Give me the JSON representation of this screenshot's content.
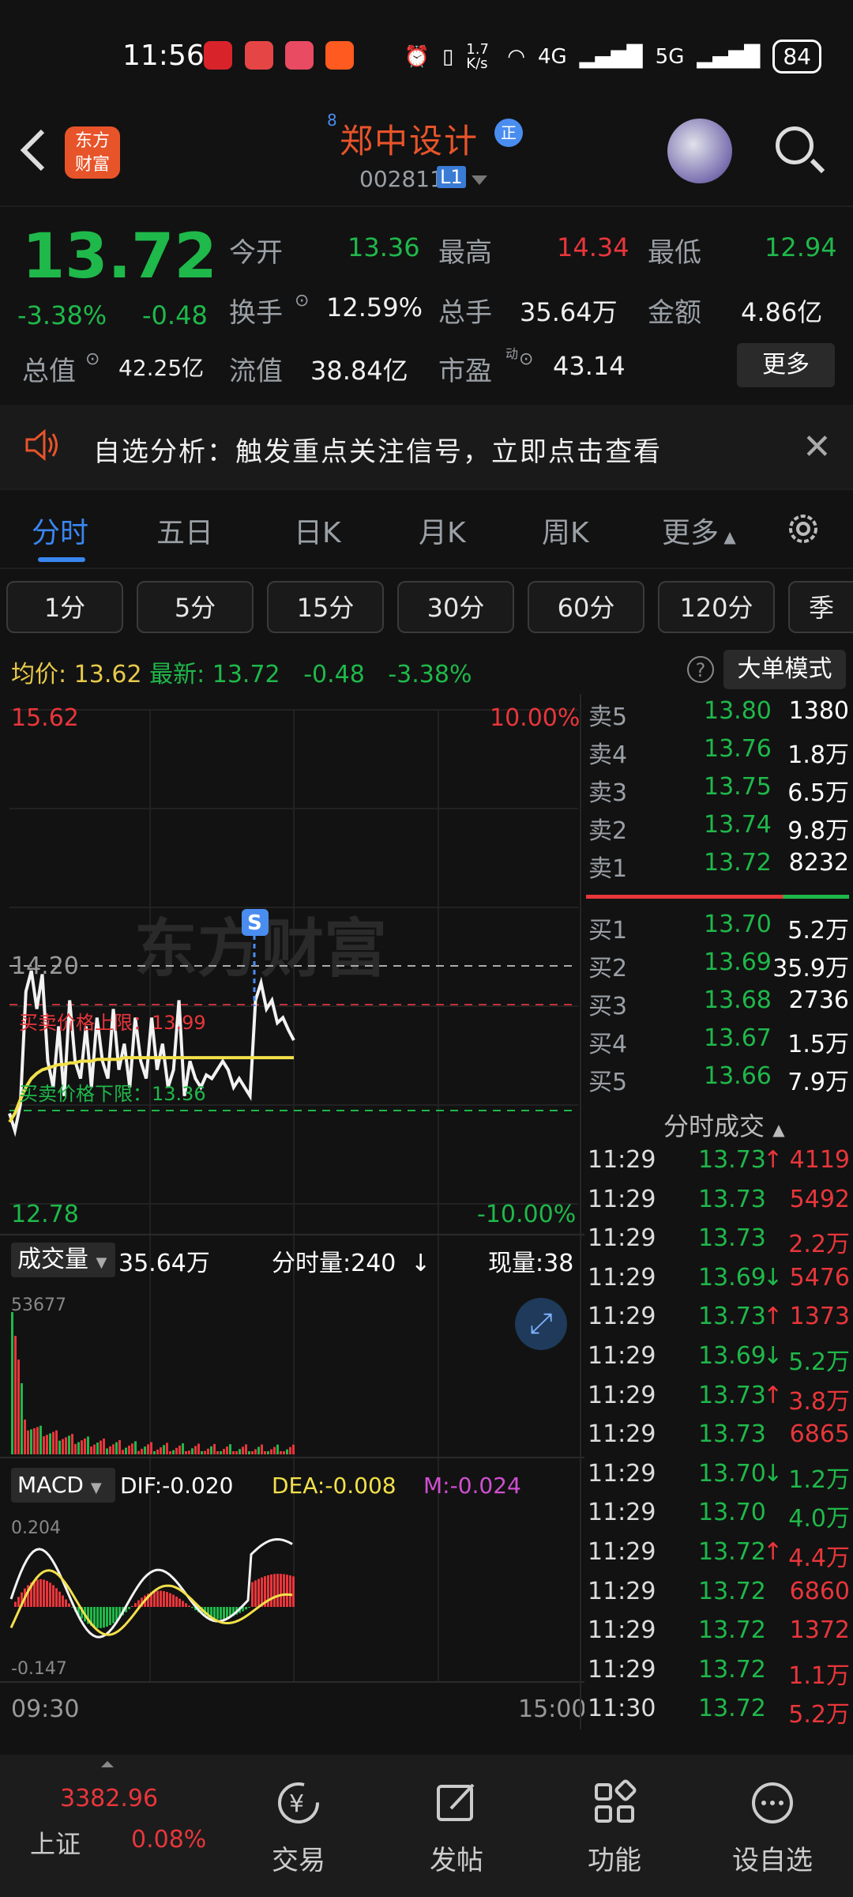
{
  "status_bar": {
    "time": "11:56",
    "speed": "1.7\nK/s",
    "net1": "4G",
    "net2": "5G",
    "battery": "84"
  },
  "header": {
    "stock_name": "郑中设计",
    "superscript": "8",
    "badge": "正",
    "code": "002811",
    "level": "L1",
    "logo_line1": "东方",
    "logo_line2": "财富"
  },
  "quote": {
    "price": "13.72",
    "pct": "-3.38%",
    "change": "-0.48",
    "open_label": "今开",
    "open": "13.36",
    "high_label": "最高",
    "high": "14.34",
    "low_label": "最低",
    "low": "12.94",
    "turnover_label": "换手",
    "turnover": "12.59%",
    "volume_label": "总手",
    "volume": "35.64万",
    "amount_label": "金额",
    "amount": "4.86亿",
    "mcap_label": "总值",
    "mcap": "42.25亿",
    "float_label": "流值",
    "float": "38.84亿",
    "pe_label": "市盈",
    "pe_sup": "动",
    "pe": "43.14",
    "more": "更多"
  },
  "banner": {
    "text": "自选分析：触发重点关注信号，立即点击查看"
  },
  "tabs": [
    "分时",
    "五日",
    "日K",
    "月K",
    "周K",
    "更多"
  ],
  "intervals": [
    "1分",
    "5分",
    "15分",
    "30分",
    "60分",
    "120分",
    "季"
  ],
  "summary": {
    "avg_label": "均价:",
    "avg": "13.62",
    "latest_label": "最新:",
    "latest": "13.72",
    "change": "-0.48",
    "pct": "-3.38%",
    "big_order": "大单模式"
  },
  "chart": {
    "y_top": "15.62",
    "y_bottom": "12.78",
    "pct_top": "10.00%",
    "pct_bottom": "-10.00%",
    "ref_line": "14.20",
    "upper_label": "买卖价格上限：13.99",
    "lower_label": "买卖价格下限：13.36",
    "s_marker": "S",
    "watermark": "东方财富",
    "time_start": "09:30",
    "time_end": "15:00"
  },
  "chart_data": {
    "type": "line",
    "series": [
      {
        "name": "价格",
        "values": [
          13.3,
          13.2,
          13.35,
          14.0,
          14.12,
          13.9,
          14.1,
          13.6,
          13.45,
          13.8,
          13.4,
          13.95,
          13.6,
          13.5,
          13.8,
          13.45,
          13.85,
          13.6,
          13.5,
          13.9,
          13.55,
          13.7,
          13.45,
          13.85,
          13.6,
          13.5,
          13.85,
          13.55,
          13.7,
          13.45,
          13.55,
          13.95,
          13.4,
          13.6,
          13.5,
          13.45,
          13.52,
          13.5,
          13.55,
          13.6,
          13.55,
          13.45,
          13.5,
          13.45,
          13.4,
          13.95,
          14.05,
          13.9,
          13.95,
          13.82,
          13.85,
          13.78,
          13.72
        ]
      },
      {
        "name": "均价",
        "values": [
          13.25,
          13.3,
          13.38,
          13.45,
          13.5,
          13.53,
          13.55,
          13.56,
          13.57,
          13.58,
          13.58,
          13.59,
          13.59,
          13.6,
          13.6,
          13.6,
          13.61,
          13.61,
          13.61,
          13.61,
          13.61,
          13.62,
          13.62,
          13.62,
          13.62,
          13.62,
          13.62,
          13.62,
          13.62,
          13.62,
          13.62,
          13.62,
          13.62,
          13.62,
          13.62,
          13.62,
          13.62,
          13.62,
          13.62,
          13.62,
          13.62,
          13.62,
          13.62,
          13.62,
          13.62,
          13.62,
          13.62,
          13.62,
          13.62,
          13.62,
          13.62,
          13.62,
          13.62
        ]
      }
    ],
    "ylim": [
      12.78,
      15.62
    ]
  },
  "volume_panel": {
    "selector": "成交量",
    "total": "35.64万",
    "tick_label": "分时量:240",
    "now_label": "现量:38",
    "max_label": "53677"
  },
  "macd_panel": {
    "selector": "MACD",
    "dif": "DIF:-0.020",
    "dea": "DEA:-0.008",
    "m": "M:-0.024",
    "top": "0.204",
    "bottom": "-0.147"
  },
  "order_book": {
    "sells": [
      {
        "label": "卖5",
        "price": "13.80",
        "vol": "1380"
      },
      {
        "label": "卖4",
        "price": "13.76",
        "vol": "1.8万"
      },
      {
        "label": "卖3",
        "price": "13.75",
        "vol": "6.5万"
      },
      {
        "label": "卖2",
        "price": "13.74",
        "vol": "9.8万"
      },
      {
        "label": "卖1",
        "price": "13.72",
        "vol": "8232"
      }
    ],
    "buys": [
      {
        "label": "买1",
        "price": "13.70",
        "vol": "5.2万"
      },
      {
        "label": "买2",
        "price": "13.69",
        "vol": "35.9万"
      },
      {
        "label": "买3",
        "price": "13.68",
        "vol": "2736"
      },
      {
        "label": "买4",
        "price": "13.67",
        "vol": "1.5万"
      },
      {
        "label": "买5",
        "price": "13.66",
        "vol": "7.9万"
      }
    ]
  },
  "trades": {
    "title": "分时成交",
    "rows": [
      {
        "time": "11:29",
        "price": "13.73",
        "arrow": "↑",
        "vol": "4119"
      },
      {
        "time": "11:29",
        "price": "13.73",
        "arrow": "",
        "vol": "5492"
      },
      {
        "time": "11:29",
        "price": "13.73",
        "arrow": "",
        "vol": "2.2万"
      },
      {
        "time": "11:29",
        "price": "13.69",
        "arrow": "↓",
        "vol": "5476"
      },
      {
        "time": "11:29",
        "price": "13.73",
        "arrow": "↑",
        "vol": "1373"
      },
      {
        "time": "11:29",
        "price": "13.69",
        "arrow": "↓",
        "vol": "5.2万"
      },
      {
        "time": "11:29",
        "price": "13.73",
        "arrow": "↑",
        "vol": "3.8万"
      },
      {
        "time": "11:29",
        "price": "13.73",
        "arrow": "",
        "vol": "6865"
      },
      {
        "time": "11:29",
        "price": "13.70",
        "arrow": "↓",
        "vol": "1.2万"
      },
      {
        "time": "11:29",
        "price": "13.70",
        "arrow": "",
        "vol": "4.0万"
      },
      {
        "time": "11:29",
        "price": "13.72",
        "arrow": "↑",
        "vol": "4.4万"
      },
      {
        "time": "11:29",
        "price": "13.72",
        "arrow": "",
        "vol": "6860"
      },
      {
        "time": "11:29",
        "price": "13.72",
        "arrow": "",
        "vol": "1372"
      },
      {
        "time": "11:29",
        "price": "13.72",
        "arrow": "",
        "vol": "1.1万"
      },
      {
        "time": "11:30",
        "price": "13.72",
        "arrow": "",
        "vol": "5.2万"
      }
    ]
  },
  "bottom_nav": {
    "index_value": "3382.96",
    "index_name": "上证",
    "index_pct": "0.08%",
    "trade": "交易",
    "post": "发帖",
    "function": "功能",
    "watchlist": "设自选"
  },
  "colors": {
    "up": "#e8363b",
    "down": "#1fb84a",
    "accent": "#3a86f0",
    "brand": "#e8542a"
  }
}
